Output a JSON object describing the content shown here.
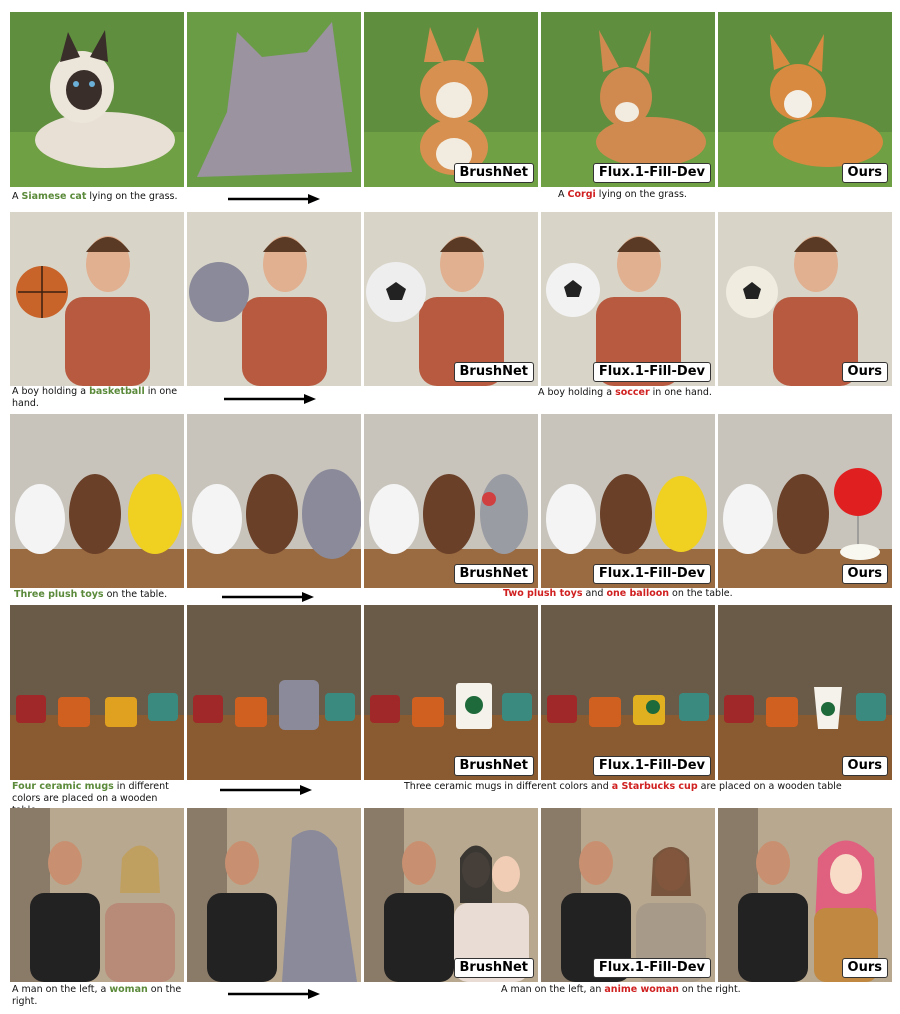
{
  "labels": {
    "brushnet": "BrushNet",
    "flux": "Flux.1-Fill-Dev",
    "ours": "Ours"
  },
  "rows": [
    {
      "src": {
        "pre": "A ",
        "hl": "Siamese cat",
        "post": " lying on the grass."
      },
      "tgt": {
        "pre": "A ",
        "hl": "Corgi",
        "post": " lying on the grass."
      }
    },
    {
      "src": {
        "pre": "A boy holding a ",
        "hl": "basketball",
        "post": " in one hand."
      },
      "tgt": {
        "pre": "A boy holding a ",
        "hl": "soccer",
        "post": " in one hand."
      }
    },
    {
      "src": {
        "pre": "",
        "hl": "Three plush toys",
        "post": " on the table."
      },
      "tgt": {
        "pre": "",
        "hl": "Two plush toys",
        "mid": " and ",
        "hl2": "one balloon",
        "post": " on the table."
      }
    },
    {
      "src": {
        "pre": "",
        "hl": "Four ceramic mugs",
        "post": " in different colors are placed on a wooden table"
      },
      "tgt": {
        "pre": "Three ceramic mugs in different colors and ",
        "hl": "a Starbucks cup",
        "post": " are placed on a wooden table"
      }
    },
    {
      "src": {
        "pre": "A man on the left, a ",
        "hl": "woman",
        "post": " on the right."
      },
      "tgt": {
        "pre": "A man on the left, an ",
        "hl": "anime woman",
        "post": " on the right."
      }
    }
  ],
  "colors": {
    "source_highlight": "#5a8a3a",
    "target_highlight": "#d02020"
  }
}
